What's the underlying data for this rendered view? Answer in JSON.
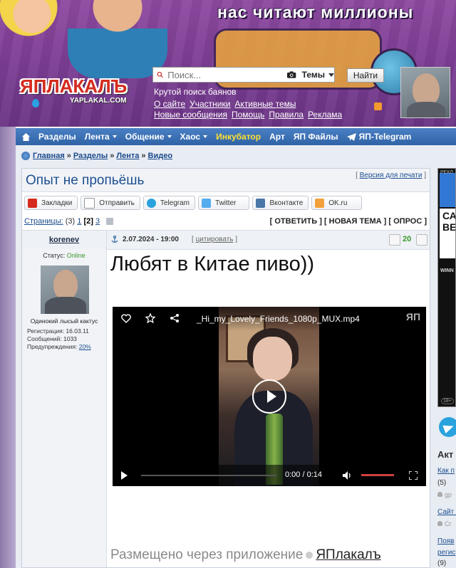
{
  "header": {
    "slogan": "нас читают миллионы",
    "logo_main": "ЯПЛАКАЛЪ",
    "logo_sub": "YAPLAKAL.COM",
    "search": {
      "placeholder": "Поиск...",
      "scope": "Темы",
      "button": "Найти"
    },
    "tagline": "Крутой поиск баянов",
    "links_row1": [
      "О сайте",
      "Участники",
      "Активные темы"
    ],
    "links_row2": [
      "Новые сообщения",
      "Помощь",
      "Правила",
      "Реклама"
    ]
  },
  "nav": {
    "items": [
      "Разделы",
      "Лента",
      "Общение",
      "Хаос",
      "Инкубатор",
      "Арт",
      "ЯП Файлы",
      "ЯП-Telegram"
    ]
  },
  "breadcrumb": [
    "Главная",
    "Разделы",
    "Лента",
    "Видео"
  ],
  "topic": {
    "title": "Опыт не пропьёшь",
    "print_link": "Версия для печати",
    "share": [
      "Закладки",
      "Отправить",
      "Telegram",
      "Twitter",
      "Вконтакте",
      "OK.ru"
    ],
    "pages_label": "Страницы:",
    "pages_count": "(3)",
    "pages": [
      "1",
      "[2]",
      "3"
    ],
    "actions": "[ ОТВЕТИТЬ ] [ НОВАЯ ТЕМА ] [ ОПРОС ]"
  },
  "post": {
    "author": "korenev",
    "date": "2.07.2024 - 19:00",
    "quote": "цитировать",
    "rating": "20",
    "status_label": "Статус:",
    "status_value": "Online",
    "user_title": "Одинокий лысый кактус",
    "reg": "Регистрация: 16.03.11",
    "messages": "Сообщений: 1033",
    "warnings_label": "Предупреждения:",
    "warnings_value": "20%",
    "text": "Любят в Китае пиво))",
    "video": {
      "filename": "_Hi_my_Lovely_Friends_1080p_MUX.mp4",
      "watermark": "ЯП",
      "time": "0:00  /  0:14"
    },
    "footer_prefix": "Размещено через приложение",
    "footer_link": "ЯПлакалъ"
  },
  "right": {
    "ad_label": "РЕКЛ",
    "ad_text": "СА ВЕ",
    "ad_win": "WINN",
    "ad_age": "18+",
    "title": "Акт",
    "items": [
      {
        "link": "Как п",
        "count": "(5)",
        "user": "gp"
      },
      {
        "link": "Сайт з",
        "count": "",
        "user": "Сг"
      },
      {
        "link": "Появ",
        "count": "",
        "user": ""
      },
      {
        "link": "регис",
        "count": "(9)",
        "user": ""
      }
    ]
  },
  "colors": {
    "nav_bg": "#2f63a6",
    "banner_bg": "#7c3d93",
    "link": "#1d4f8f",
    "online": "#3a9a2a",
    "incubator": "#ffe033"
  }
}
